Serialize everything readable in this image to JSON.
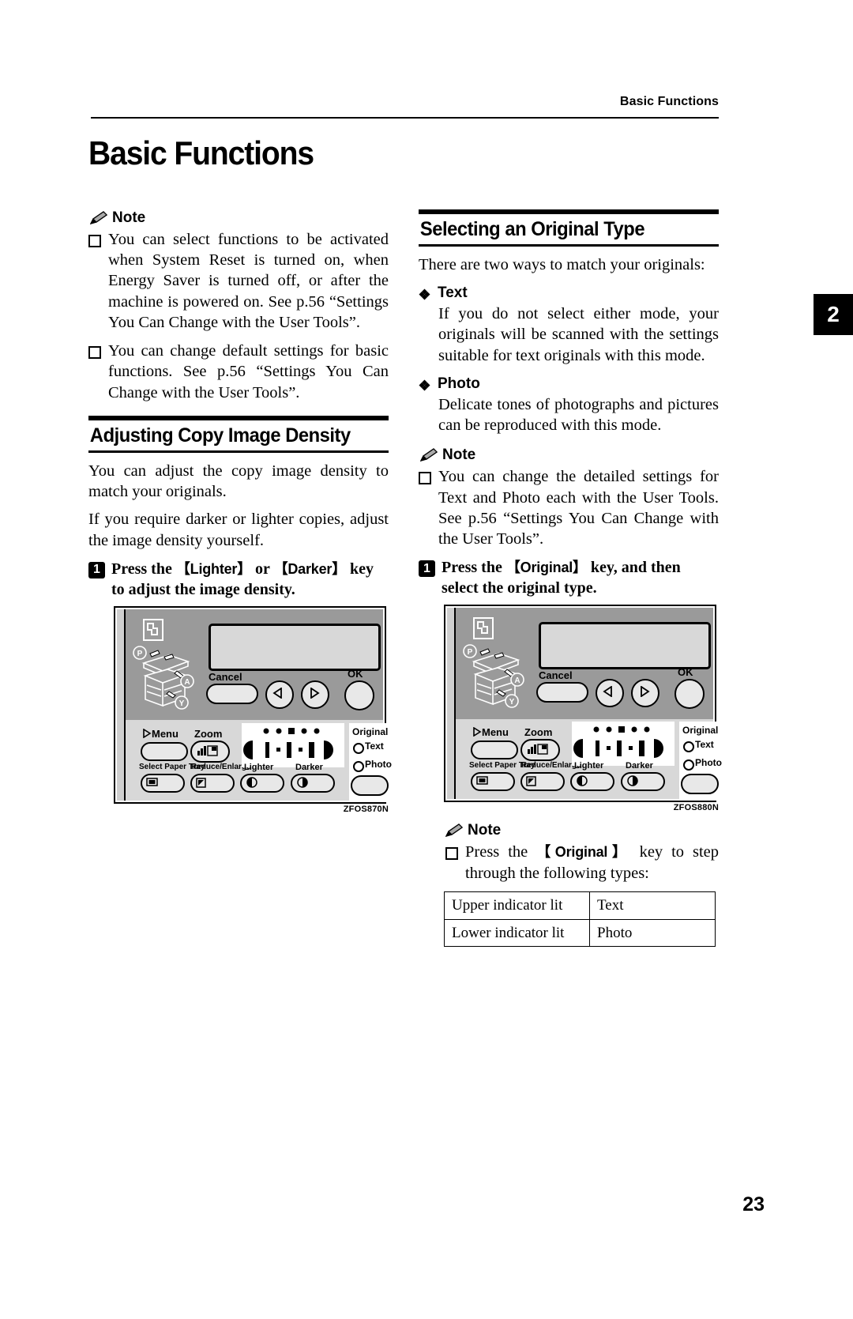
{
  "running_header": "Basic Functions",
  "chapter_title": "Basic Functions",
  "chapter_tab": "2",
  "page_number": "23",
  "left_column": {
    "note": {
      "label": "Note",
      "items": [
        "You can select functions to be activated when System Reset is turned on, when Energy Saver is turned off, or after the machine is powered on. See p.56 “Settings You Can Change with the User Tools”.",
        "You can change default settings for basic functions. See p.56 “Settings You Can Change with the User Tools”."
      ]
    },
    "section": {
      "heading": "Adjusting Copy Image Density",
      "paragraphs": [
        "You can adjust the copy image density to match your originals.",
        "If you require darker or lighter copies, adjust the image density yourself."
      ],
      "step": {
        "number": "1",
        "text_before": "Press the ",
        "key_1": "【Lighter】",
        "text_middle": " or ",
        "key_2": "【Darker】",
        "text_after": " key to adjust the image density."
      },
      "figure": {
        "caption": "ZFOS870N",
        "labels": {
          "cancel": "Cancel",
          "ok": "OK",
          "menu": "Menu",
          "zoom": "Zoom",
          "select_paper_tray": "Select Paper Tray",
          "reduce_enlarge": "Reduce/Enlarge",
          "lighter": "Lighter",
          "darker": "Darker",
          "original": "Original",
          "text": "Text",
          "photo": "Photo",
          "misfeed_p": "P",
          "misfeed_a": "A",
          "misfeed_y": "Y"
        }
      }
    }
  },
  "right_column": {
    "section": {
      "heading": "Selecting an Original Type",
      "intro": "There are two ways to match your originals:",
      "bullets": [
        {
          "title": "Text",
          "body": "If you do not select either mode, your originals will be scanned with the settings suitable for text originals with this mode."
        },
        {
          "title": "Photo",
          "body": "Delicate tones of photographs and pictures can be reproduced with this mode."
        }
      ],
      "note_1": {
        "label": "Note",
        "items": [
          "You can change the detailed settings for Text and Photo each with the User Tools. See p.56 “Settings You Can Change with the User Tools”."
        ]
      },
      "step": {
        "number": "1",
        "text_before": "Press the ",
        "key_1": "【Original】",
        "text_after": " key, and then select the original type."
      },
      "figure": {
        "caption": "ZFOS880N",
        "labels": {
          "cancel": "Cancel",
          "ok": "OK",
          "menu": "Menu",
          "zoom": "Zoom",
          "select_paper_tray": "Select Paper Tray",
          "reduce_enlarge": "Reduce/Enlarge",
          "lighter": "Lighter",
          "darker": "Darker",
          "original": "Original",
          "text": "Text",
          "photo": "Photo",
          "misfeed_p": "P",
          "misfeed_a": "A",
          "misfeed_y": "Y"
        }
      },
      "note_2": {
        "label": "Note",
        "items_parts": {
          "before": "Press the ",
          "key": "【Original】",
          "after": " key to step through the following types:"
        }
      },
      "table": {
        "rows": [
          {
            "indicator": "Upper indicator lit",
            "type": "Text"
          },
          {
            "indicator": "Lower indicator lit",
            "type": "Photo"
          }
        ]
      }
    }
  }
}
